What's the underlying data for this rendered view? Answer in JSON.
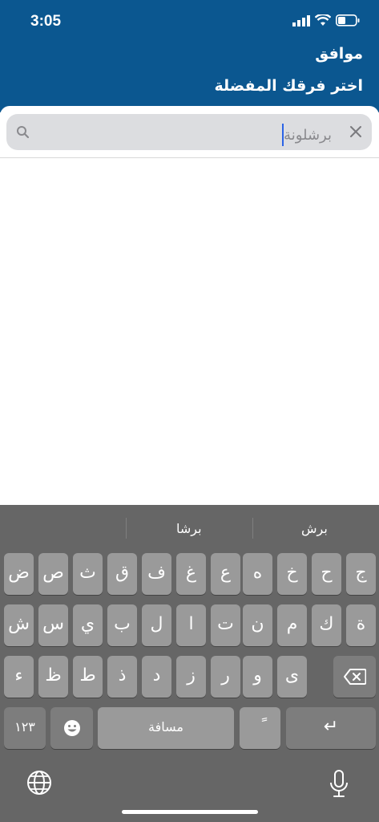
{
  "status_bar": {
    "time": "3:05"
  },
  "header": {
    "confirm_label": "موافق",
    "title": "اختر فرقك المفضلة"
  },
  "search": {
    "value": "برشلونة"
  },
  "keyboard": {
    "suggestions": [
      "برش",
      "برشا",
      ""
    ],
    "rows": [
      [
        "ض",
        "ص",
        "ث",
        "ق",
        "ف",
        "غ",
        "ع",
        "ه",
        "خ",
        "ح",
        "ج"
      ],
      [
        "ش",
        "س",
        "ي",
        "ب",
        "ل",
        "ا",
        "ت",
        "ن",
        "م",
        "ك",
        "ة"
      ],
      [
        "ء",
        "ظ",
        "ط",
        "ذ",
        "د",
        "ز",
        "ر",
        "و",
        "ى"
      ]
    ],
    "numbers_label": "١٢٣",
    "space_label": "مسافة",
    "tanween_label": "ً",
    "return_label": "↵"
  }
}
